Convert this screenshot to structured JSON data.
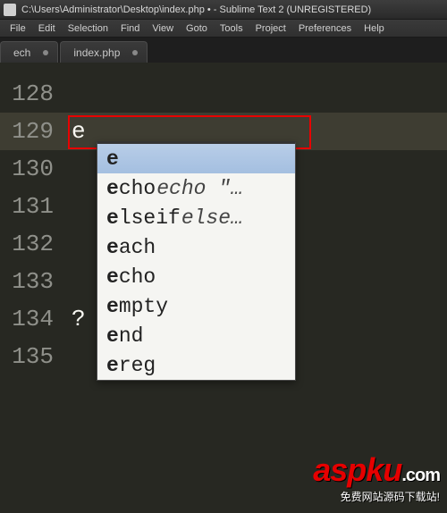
{
  "window": {
    "title": "C:\\Users\\Administrator\\Desktop\\index.php • - Sublime Text 2 (UNREGISTERED)"
  },
  "menu": {
    "items": [
      "File",
      "Edit",
      "Selection",
      "Find",
      "View",
      "Goto",
      "Tools",
      "Project",
      "Preferences",
      "Help"
    ]
  },
  "tabs": [
    {
      "label": "ech",
      "dirty": true
    },
    {
      "label": "index.php",
      "dirty": true
    }
  ],
  "editor": {
    "lines": [
      {
        "num": "128",
        "text": "",
        "active": false
      },
      {
        "num": "129",
        "text": "e",
        "active": true
      },
      {
        "num": "130",
        "text": "",
        "active": false
      },
      {
        "num": "131",
        "text": "",
        "active": false
      },
      {
        "num": "132",
        "text": "",
        "active": false
      },
      {
        "num": "133",
        "text": "",
        "active": false
      },
      {
        "num": "134",
        "text": "?",
        "active": false
      },
      {
        "num": "135",
        "text": "",
        "active": false
      }
    ],
    "typed": "e"
  },
  "autocomplete": {
    "selected": 0,
    "items": [
      {
        "match": "e",
        "rest": "",
        "hint": ""
      },
      {
        "match": "e",
        "rest": "cho",
        "hint": "echo \"…"
      },
      {
        "match": "e",
        "rest": "lseif",
        "hint": "else…"
      },
      {
        "match": "e",
        "rest": "ach",
        "hint": ""
      },
      {
        "match": "e",
        "rest": "cho",
        "hint": ""
      },
      {
        "match": "e",
        "rest": "mpty",
        "hint": ""
      },
      {
        "match": "e",
        "rest": "nd",
        "hint": ""
      },
      {
        "match": "e",
        "rest": "reg",
        "hint": ""
      }
    ]
  },
  "watermark": {
    "brand": "aspku",
    "tld": ".com",
    "slogan": "免费网站源码下载站!"
  }
}
